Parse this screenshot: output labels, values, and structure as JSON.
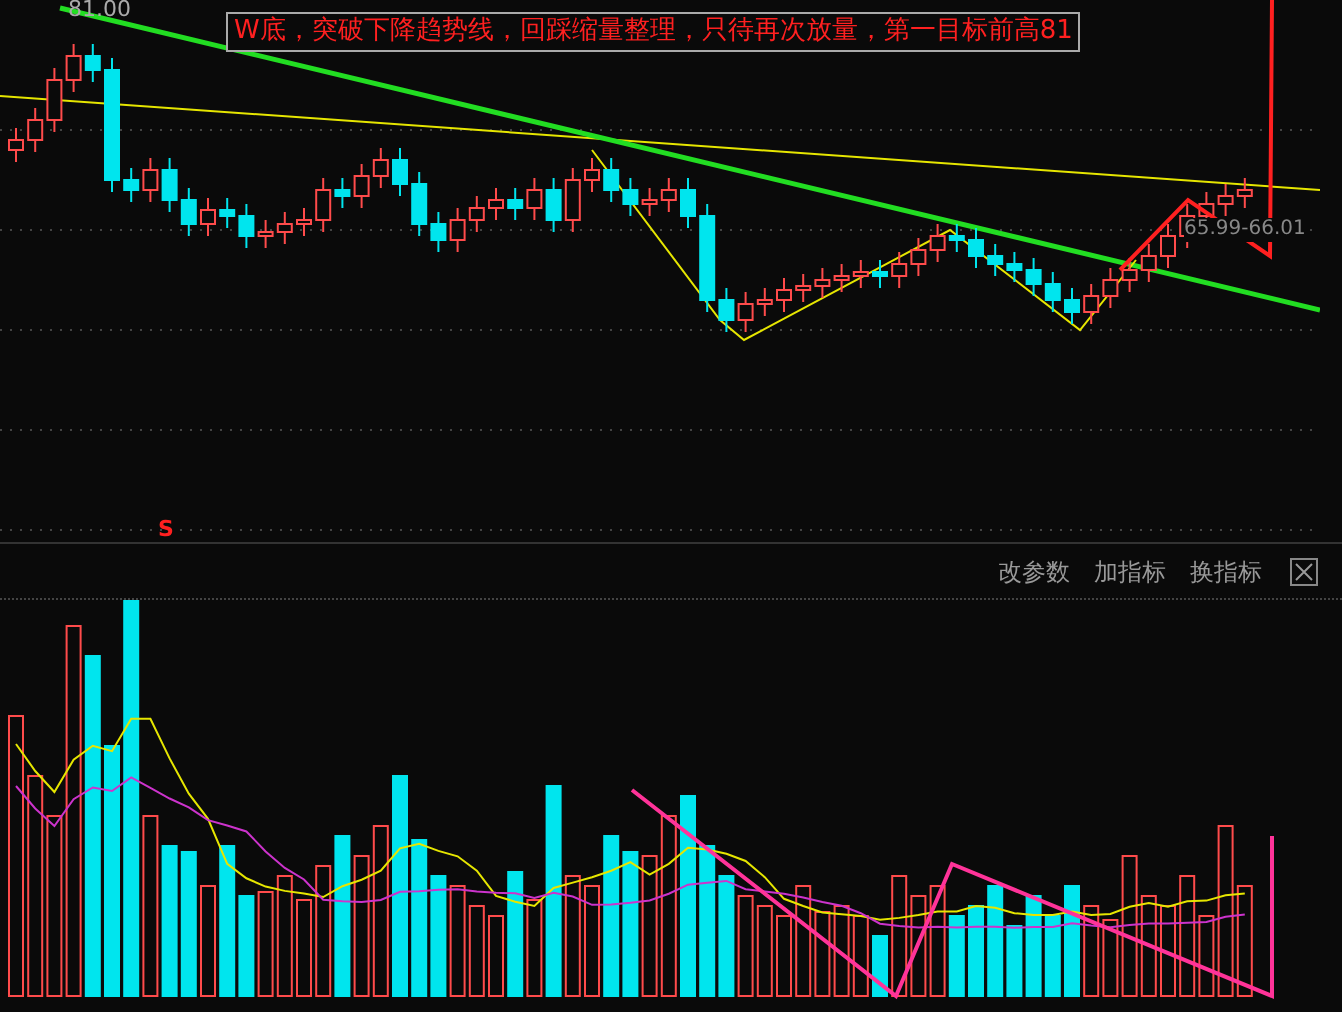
{
  "price_chart": {
    "high_label": "81.00",
    "annotation": "W底，突破下降趋势线，回踩缩量整理，只待再次放量，第一目标前高81",
    "price_label": "65.99-66.01",
    "signal_mark": "S"
  },
  "indicator_toolbar": {
    "buttons": [
      "改参数",
      "加指标",
      "换指标"
    ]
  }
}
